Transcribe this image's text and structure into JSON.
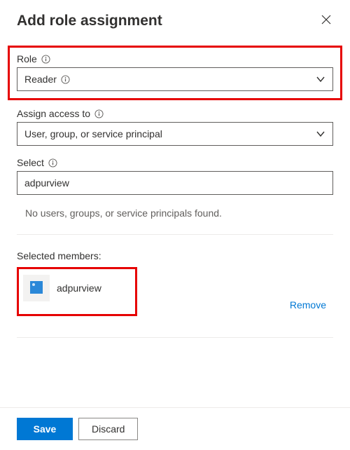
{
  "header": {
    "title": "Add role assignment"
  },
  "fields": {
    "role": {
      "label": "Role",
      "value": "Reader"
    },
    "assign": {
      "label": "Assign access to",
      "value": "User, group, or service principal"
    },
    "select": {
      "label": "Select",
      "value": "adpurview"
    }
  },
  "results": {
    "empty_text": "No users, groups, or service principals found."
  },
  "selected": {
    "label": "Selected members:",
    "members": [
      {
        "name": "adpurview"
      }
    ],
    "remove_label": "Remove"
  },
  "footer": {
    "save": "Save",
    "discard": "Discard"
  }
}
